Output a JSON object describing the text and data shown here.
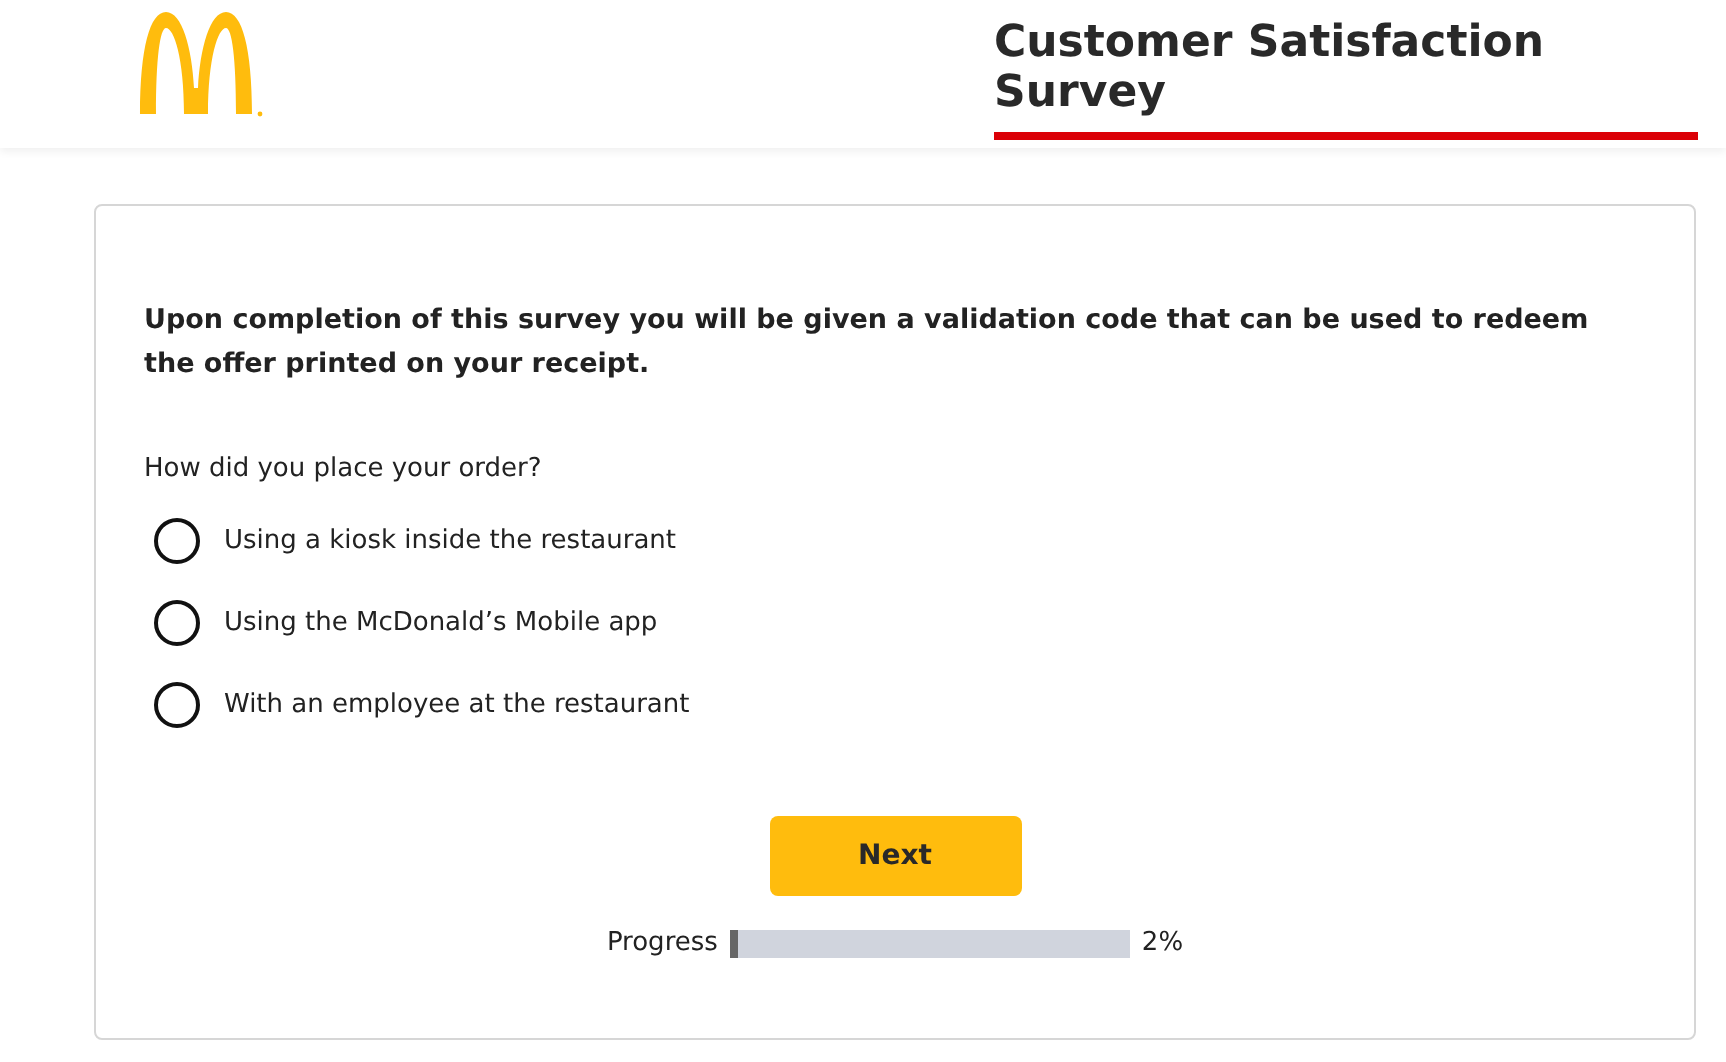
{
  "header": {
    "title": "Customer Satisfaction Survey"
  },
  "intro": "Upon completion of this survey you will be given a validation code that can be used to redeem the offer printed on your receipt.",
  "question": "How did you place your order?",
  "options": [
    {
      "label": "Using a kiosk inside the restaurant",
      "selected": false
    },
    {
      "label": "Using the McDonald’s Mobile app",
      "selected": false
    },
    {
      "label": "With an employee at the restaurant",
      "selected": false
    }
  ],
  "next_button": "Next",
  "progress": {
    "label": "Progress",
    "level": 0.02,
    "reading": "2%"
  }
}
